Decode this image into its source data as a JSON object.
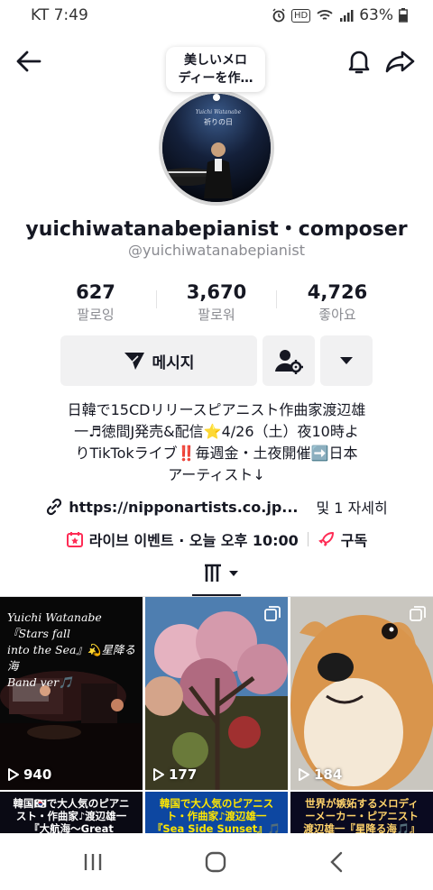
{
  "status_bar": {
    "carrier_time": "KT 7:49",
    "hd": "HD",
    "battery": "63%"
  },
  "header": {
    "bubble_text": "美しいメロ\nディーを作…"
  },
  "profile": {
    "name": "yuichiwatanabepianist・composer",
    "handle": "@yuichiwatanabepianist"
  },
  "stats": [
    {
      "value": "627",
      "label": "팔로잉"
    },
    {
      "value": "3,670",
      "label": "팔로워"
    },
    {
      "value": "4,726",
      "label": "좋아요"
    }
  ],
  "actions": {
    "message_label": "메시지"
  },
  "bio": "日韓で15CDリリースピアニスト作曲家渡辺雄\n一♬徳間J発売&配信⭐4/26（土）夜10時よ\nりTikTokライブ‼️毎週金・土夜開催➡️日本\nアーティスト↓",
  "link": {
    "url": "https://nipponartists.co.jp...",
    "more": "및 1 자세히"
  },
  "event": {
    "text": "라이브 이벤트 · 오늘 오후 10:00",
    "subscribe": "구독"
  },
  "grid": [
    {
      "title": "Yuichi Watanabe『Stars fall\ninto the Sea』💫星降る海\nBand ver🎵",
      "views": "940"
    },
    {
      "views": "177"
    },
    {
      "views": "184"
    }
  ],
  "grid_row2": [
    {
      "text": "韓国🇰🇷で大人気のピアニ\nスト・作曲家♪渡辺雄一\n『大航海〜Great"
    },
    {
      "text": "韓国で大人気のピアニス\nト・作曲家♪渡辺雄一\n『Sea Side Sunset』🎵"
    },
    {
      "text": "世界が嫉妬するメロディ\nーメーカー・ピアニスト\n渡辺雄一『星降る海🎵』"
    }
  ],
  "colors": {
    "accent_red": "#fe2c55",
    "text_primary": "#161823",
    "text_secondary": "#8a8b91",
    "button_bg": "#f1f1f2"
  }
}
